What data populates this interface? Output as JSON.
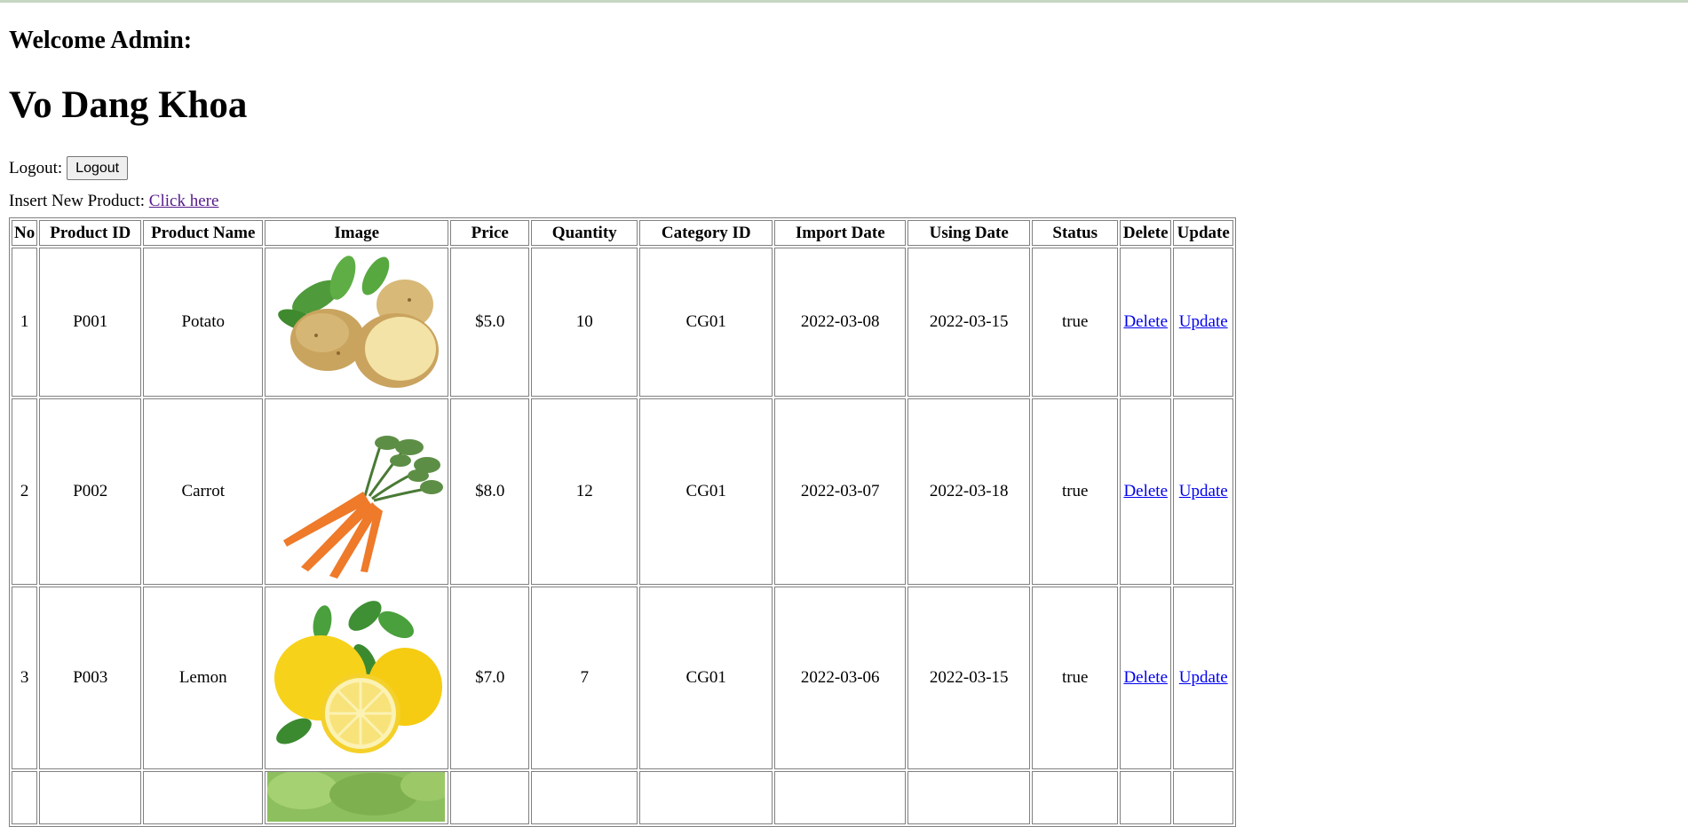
{
  "header": {
    "welcome": "Welcome Admin:",
    "user_name": "Vo Dang Khoa",
    "logout_label": "Logout:",
    "logout_button": "Logout",
    "insert_label": "Insert New Product:",
    "insert_link": "Click here"
  },
  "table": {
    "headers": [
      "No",
      "Product ID",
      "Product Name",
      "Image",
      "Price",
      "Quantity",
      "Category ID",
      "Import Date",
      "Using Date",
      "Status",
      "Delete",
      "Update"
    ],
    "rows": [
      {
        "no": "1",
        "id": "P001",
        "name": "Potato",
        "image": "potato-image",
        "price": "$5.0",
        "quantity": "10",
        "category": "CG01",
        "import_date": "2022-03-08",
        "using_date": "2022-03-15",
        "status": "true",
        "delete": "Delete",
        "update": "Update"
      },
      {
        "no": "2",
        "id": "P002",
        "name": "Carrot",
        "image": "carrot-image",
        "price": "$8.0",
        "quantity": "12",
        "category": "CG01",
        "import_date": "2022-03-07",
        "using_date": "2022-03-18",
        "status": "true",
        "delete": "Delete",
        "update": "Update"
      },
      {
        "no": "3",
        "id": "P003",
        "name": "Lemon",
        "image": "lemon-image",
        "price": "$7.0",
        "quantity": "7",
        "category": "CG01",
        "import_date": "2022-03-06",
        "using_date": "2022-03-15",
        "status": "true",
        "delete": "Delete",
        "update": "Update"
      },
      {
        "no": "",
        "id": "",
        "name": "",
        "image": "lettuce-image",
        "price": "",
        "quantity": "",
        "category": "",
        "import_date": "",
        "using_date": "",
        "status": "",
        "delete": "",
        "update": ""
      }
    ]
  },
  "colors": {
    "link": "#0000ee",
    "visited_link": "#551a8b",
    "top_border": "#c5d6c2"
  }
}
